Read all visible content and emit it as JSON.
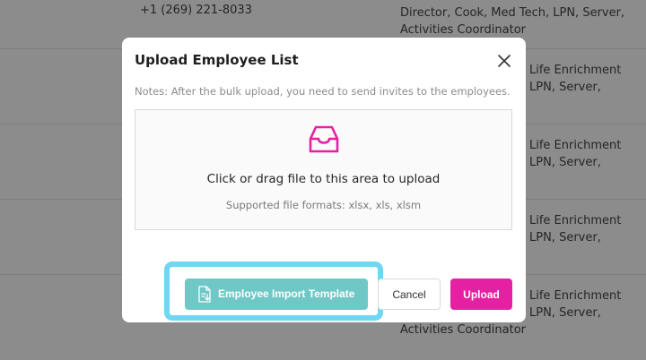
{
  "background": {
    "phone": "+1 (269) 221-8033",
    "rows": [
      {
        "lines": [
          "Director, Cook, Med Tech, LPN, Server,",
          "Activities Coordinator"
        ]
      },
      {
        "lines": [
          "Life Enrichment",
          "LPN, Server,"
        ]
      },
      {
        "lines": [
          "Life Enrichment",
          "LPN, Server,"
        ]
      },
      {
        "lines": [
          "Life Enrichment",
          "LPN, Server,"
        ]
      },
      {
        "lines": [
          "Life Enrichment",
          "LPN, Server,",
          "Activities Coordinator"
        ]
      }
    ]
  },
  "modal": {
    "title": "Upload Employee List",
    "notes": "Notes: After the bulk upload, you need to send invites to the employees.",
    "dropzone": {
      "icon": "inbox-icon",
      "text": "Click or drag file to this area to upload",
      "hint": "Supported file formats: xlsx, xls, xlsm"
    },
    "buttons": {
      "template": "Employee Import Template",
      "cancel": "Cancel",
      "upload": "Upload"
    }
  },
  "colors": {
    "accent": "#e620a3",
    "template_button": "#6fc8c6",
    "highlight": "#6fd6f4"
  }
}
